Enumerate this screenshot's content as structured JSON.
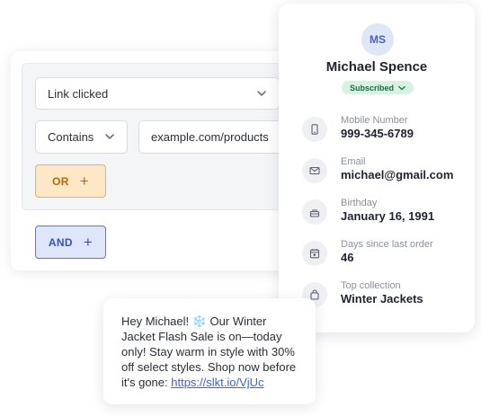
{
  "filter": {
    "event_select": "Link clicked",
    "operator_select": "Contains",
    "value_input": "example.com/products",
    "or_label": "OR",
    "and_label": "AND",
    "plus": "+"
  },
  "profile": {
    "initials": "MS",
    "name": "Michael Spence",
    "status": "Subscribed",
    "fields": [
      {
        "label": "Mobile Number",
        "value": "999-345-6789",
        "icon": "phone-icon"
      },
      {
        "label": "Email",
        "value": "michael@gmail.com",
        "icon": "mail-icon"
      },
      {
        "label": "Birthday",
        "value": "January 16, 1991",
        "icon": "cake-icon"
      },
      {
        "label": "Days since last order",
        "value": "46",
        "icon": "calendar-icon"
      },
      {
        "label": "Top collection",
        "value": "Winter Jackets",
        "icon": "bag-icon"
      }
    ]
  },
  "sms": {
    "text_before": "Hey Michael! ❄️ Our Winter Jacket Flash Sale is on—today only! Stay warm in style with 30% off select styles. Shop now before it's gone: ",
    "link": "https://slkt.io/VjUc"
  },
  "colors": {
    "or_accent": "#e9b15e",
    "and_accent": "#5a74e0",
    "subscribed_bg": "#d7f2e3",
    "link": "#3b63d6"
  }
}
